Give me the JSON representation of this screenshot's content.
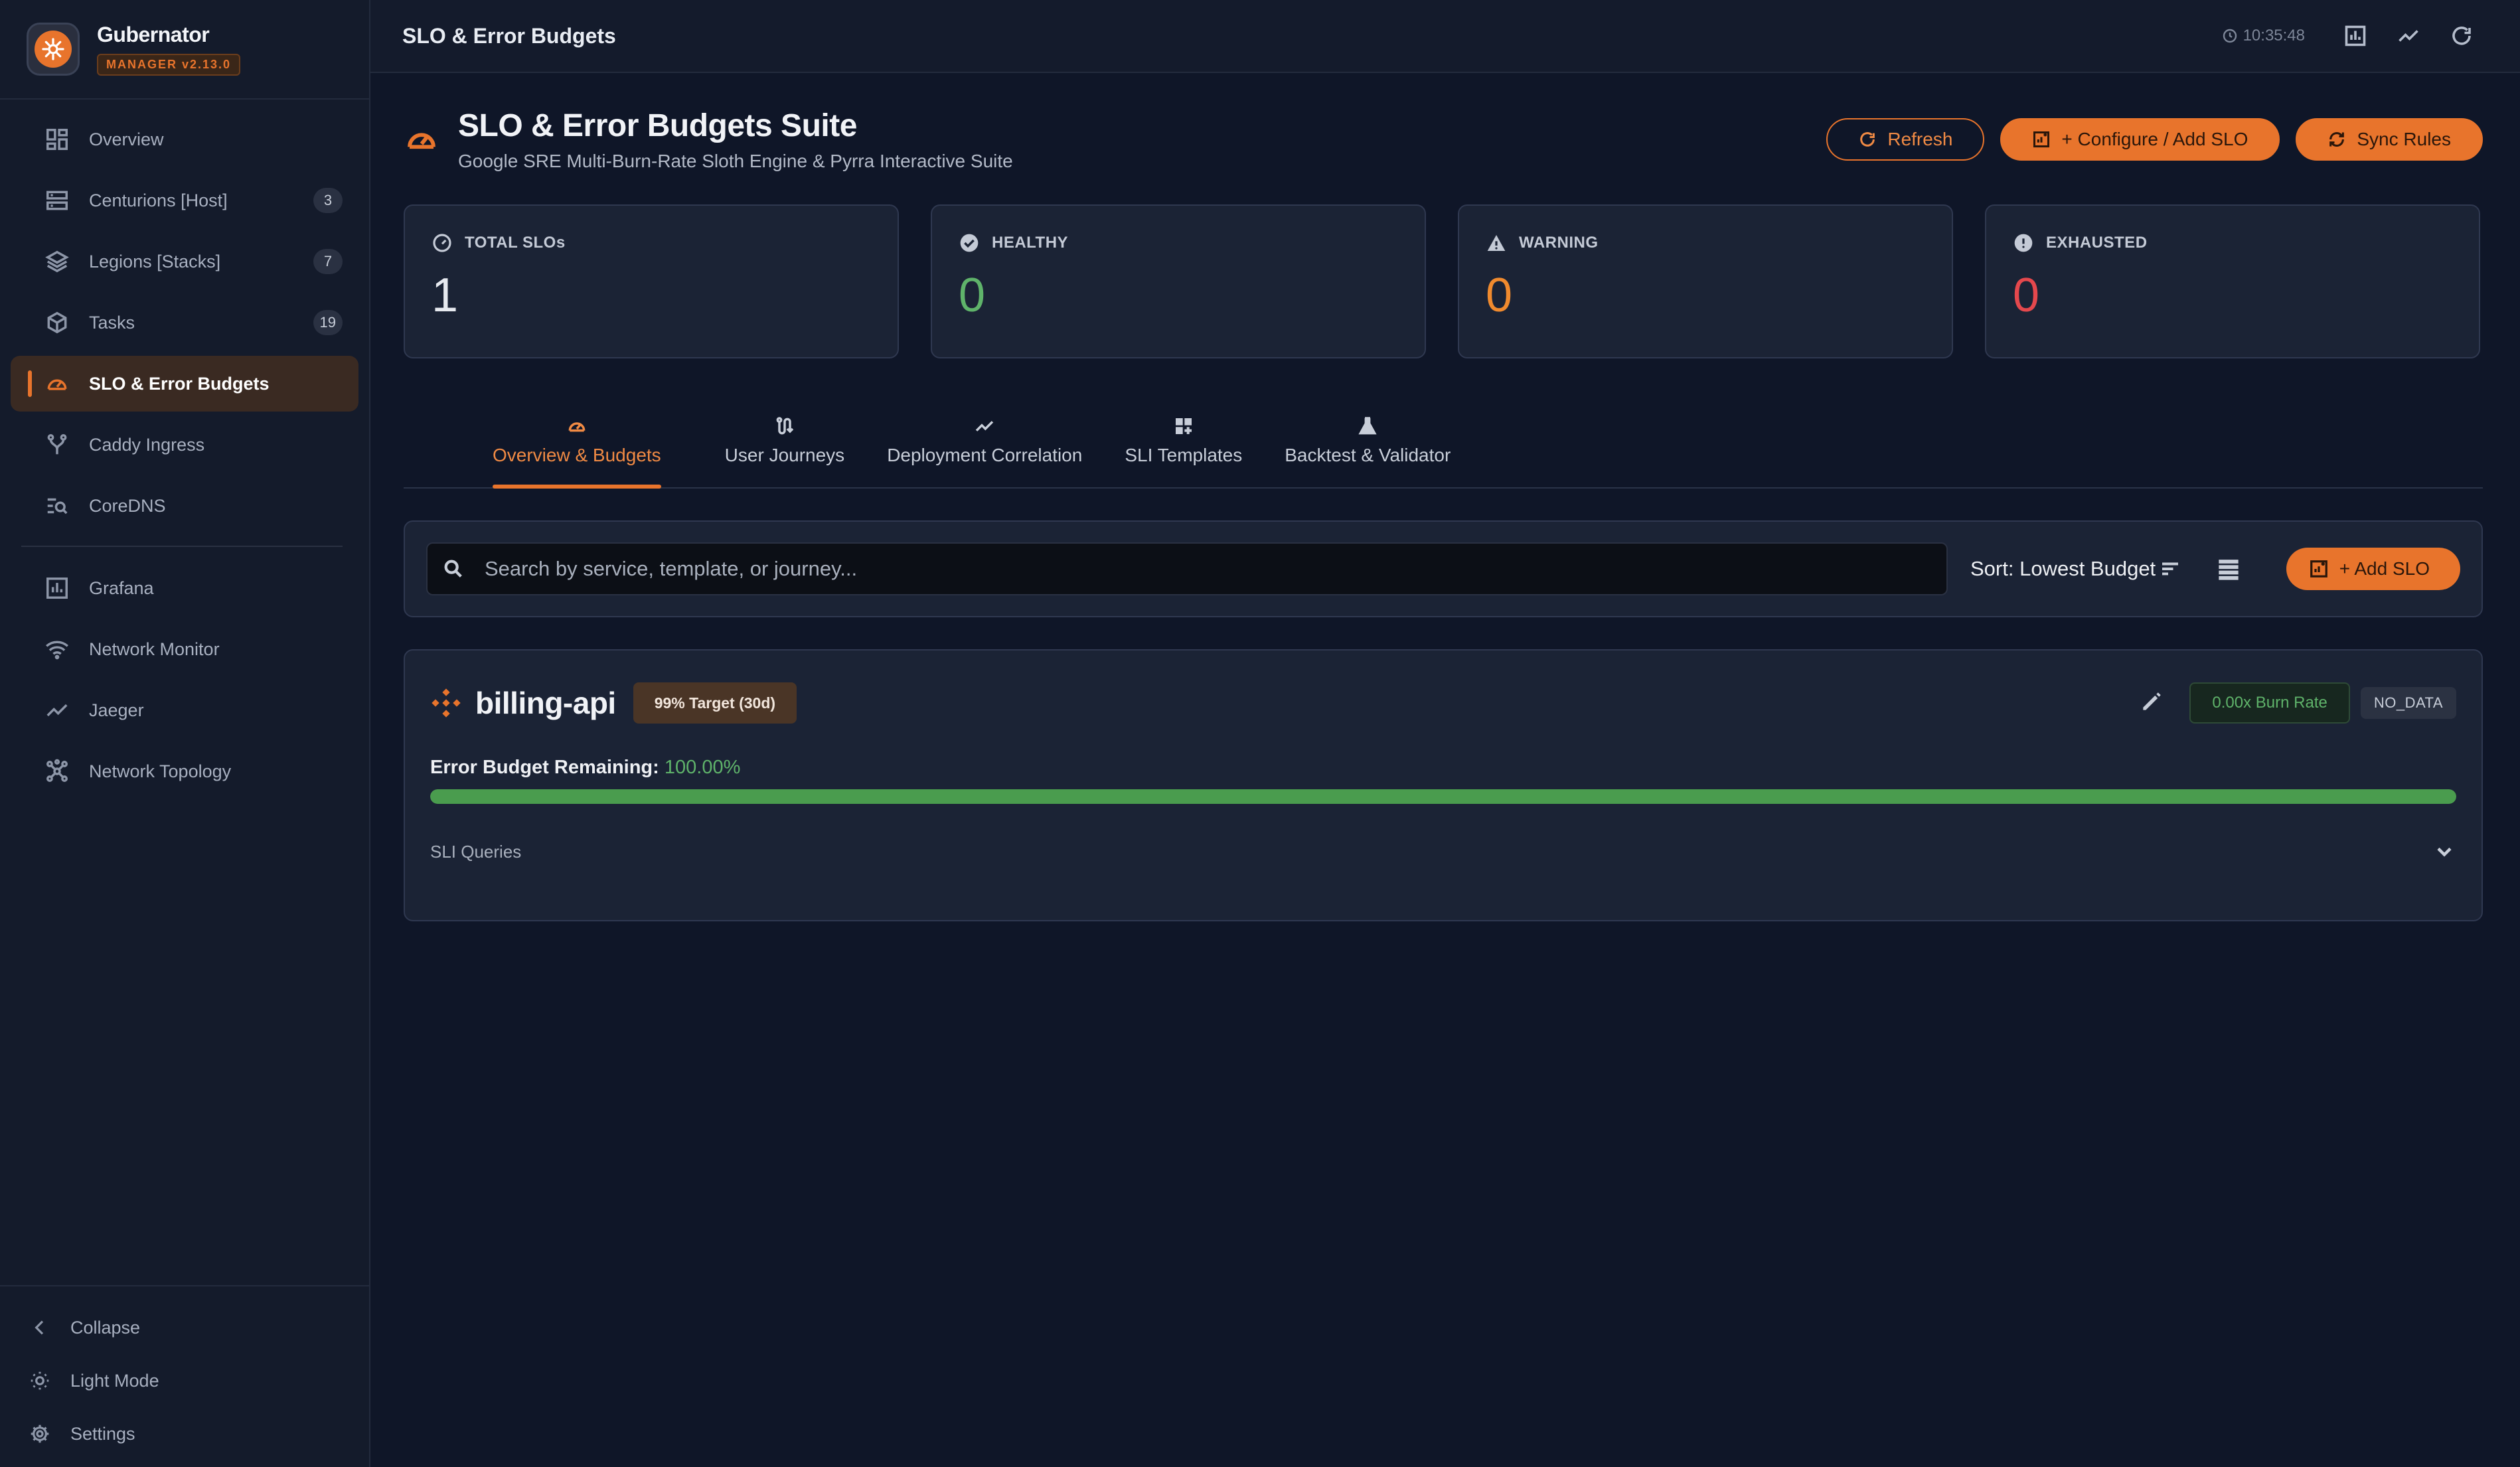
{
  "brand": {
    "name": "Gubernator",
    "version": "MANAGER v2.13.0"
  },
  "sidebar": {
    "items": [
      {
        "label": "Overview",
        "icon": "dashboard-icon"
      },
      {
        "label": "Centurions [Host]",
        "icon": "server-icon",
        "badge": "3"
      },
      {
        "label": "Legions [Stacks]",
        "icon": "layers-icon",
        "badge": "7"
      },
      {
        "label": "Tasks",
        "icon": "cube-icon",
        "badge": "19"
      },
      {
        "label": "SLO & Error Budgets",
        "icon": "gauge-icon",
        "active": true
      },
      {
        "label": "Caddy Ingress",
        "icon": "fork-icon"
      },
      {
        "label": "CoreDNS",
        "icon": "dns-search-icon"
      },
      {
        "label": "Grafana",
        "icon": "chart-box-icon"
      },
      {
        "label": "Network Monitor",
        "icon": "wifi-icon"
      },
      {
        "label": "Jaeger",
        "icon": "trend-icon"
      },
      {
        "label": "Network Topology",
        "icon": "topology-icon"
      }
    ],
    "bottom": [
      {
        "label": "Collapse",
        "icon": "chevron-left-icon"
      },
      {
        "label": "Light Mode",
        "icon": "sun-icon"
      },
      {
        "label": "Settings",
        "icon": "gear-icon"
      }
    ]
  },
  "topbar": {
    "title": "SLO & Error Budgets",
    "time": "10:35:48"
  },
  "page": {
    "title": "SLO & Error Budgets Suite",
    "subtitle": "Google SRE Multi-Burn-Rate Sloth Engine & Pyrra Interactive Suite",
    "actions": {
      "refresh": "Refresh",
      "configure": "+ Configure / Add SLO",
      "sync": "Sync Rules"
    }
  },
  "stats": [
    {
      "label": "TOTAL SLOs",
      "value": "1",
      "color": "#e6e9ef",
      "icon": "gauge-icon"
    },
    {
      "label": "HEALTHY",
      "value": "0",
      "color": "#5fb36a",
      "icon": "check-circle-icon"
    },
    {
      "label": "WARNING",
      "value": "0",
      "color": "#f08a2e",
      "icon": "warning-icon"
    },
    {
      "label": "EXHAUSTED",
      "value": "0",
      "color": "#e5484d",
      "icon": "alert-circle-icon"
    }
  ],
  "tabs": [
    {
      "label": "Overview & Budgets",
      "active": true
    },
    {
      "label": "User Journeys"
    },
    {
      "label": "Deployment Correlation"
    },
    {
      "label": "SLI Templates"
    },
    {
      "label": "Backtest & Validator"
    }
  ],
  "toolbar": {
    "search_placeholder": "Search by service, template, or journey...",
    "search_value": "",
    "sort_label": "Sort: Lowest Budget",
    "add_label": "+ Add SLO"
  },
  "slo": {
    "name": "billing-api",
    "target": "99% Target (30d)",
    "burn_rate": "0.00x Burn Rate",
    "status": "NO_DATA",
    "budget_label": "Error Budget Remaining:",
    "budget_value": "100.00%",
    "budget_fraction": 1.0,
    "sli_label": "SLI Queries"
  },
  "colors": {
    "accent": "#e8742c",
    "healthy": "#5fb36a",
    "warning": "#f08a2e",
    "exhausted": "#e5484d"
  }
}
